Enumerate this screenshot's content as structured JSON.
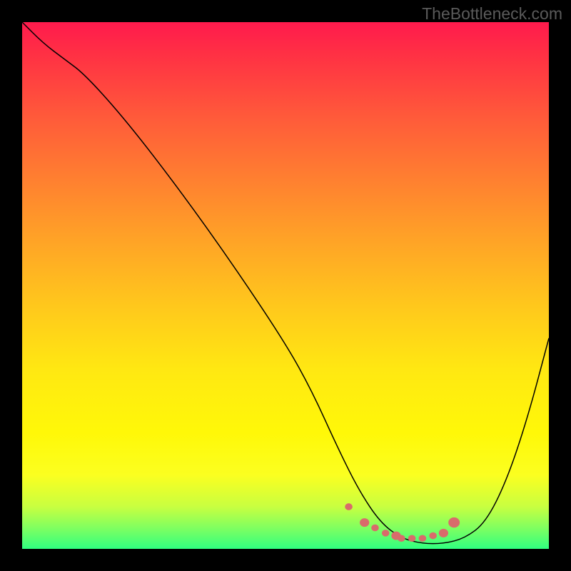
{
  "watermark": "TheBottleneck.com",
  "chart_data": {
    "type": "line",
    "title": "",
    "xlabel": "",
    "ylabel": "",
    "xlim": [
      0,
      100
    ],
    "ylim": [
      0,
      100
    ],
    "series": [
      {
        "name": "bottleneck-curve",
        "x": [
          0,
          4,
          8,
          12,
          20,
          30,
          40,
          50,
          55,
          60,
          64,
          68,
          72,
          76,
          80,
          84,
          88,
          92,
          96,
          100
        ],
        "values": [
          100,
          96,
          93,
          90,
          81,
          68,
          54,
          39,
          30,
          19,
          11,
          5,
          2,
          1,
          1,
          2,
          5,
          13,
          25,
          40
        ]
      }
    ],
    "markers": {
      "name": "optimal-range-dots",
      "x": [
        62,
        65,
        67,
        69,
        71,
        72,
        74,
        76,
        78,
        80,
        82
      ],
      "y": [
        8,
        5,
        4,
        3,
        2.5,
        2,
        2,
        2,
        2.5,
        3,
        5
      ],
      "color": "#d96b6b",
      "size_variation": [
        4,
        5,
        4,
        4,
        5,
        4,
        4,
        4,
        4,
        5,
        6
      ]
    },
    "gradient_stops": [
      {
        "pos": 0,
        "color": "#ff1a4d"
      },
      {
        "pos": 18,
        "color": "#ff5a3a"
      },
      {
        "pos": 42,
        "color": "#ffa526"
      },
      {
        "pos": 66,
        "color": "#ffe812"
      },
      {
        "pos": 86,
        "color": "#fbff20"
      },
      {
        "pos": 100,
        "color": "#30ff80"
      }
    ]
  }
}
